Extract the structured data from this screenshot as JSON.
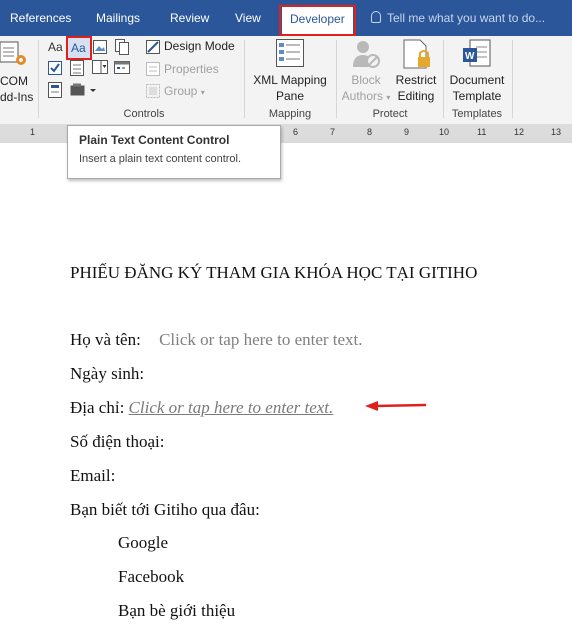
{
  "ribbon_tabs": {
    "references": "References",
    "mailings": "Mailings",
    "review": "Review",
    "view": "View",
    "developer": "Developer"
  },
  "tell_me": {
    "placeholder": "Tell me what you want to do..."
  },
  "ribbon": {
    "addins": {
      "com_addins_line1": "COM",
      "com_addins_line2": "dd-Ins"
    },
    "controls": {
      "design_mode": "Design Mode",
      "properties": "Properties",
      "group": "Group",
      "label": "Controls"
    },
    "mapping": {
      "xml_line1": "XML Mapping",
      "xml_line2": "Pane",
      "label": "Mapping"
    },
    "protect": {
      "block_line1": "Block",
      "block_line2": "Authors",
      "restrict_line1": "Restrict",
      "restrict_line2": "Editing",
      "label": "Protect"
    },
    "templates": {
      "doc_line1": "Document",
      "doc_line2": "Template",
      "label": "Templates"
    }
  },
  "ruler": {
    "ticks": [
      "1",
      "6",
      "7",
      "8",
      "9",
      "10",
      "11",
      "12",
      "13"
    ]
  },
  "tooltip": {
    "title": "Plain Text Content Control",
    "description": "Insert a plain text content control."
  },
  "document": {
    "title": "PHIẾU ĐĂNG KÝ THAM GIA KHÓA HỌC TẠI GITIHO",
    "fields": {
      "name_label": "Họ và tên:",
      "name_placeholder": "Click or tap here to enter text.",
      "dob_label": "Ngày sinh:",
      "address_label": "Địa chỉ:",
      "address_placeholder": "Click or tap here to enter text.",
      "phone_label": "Số điện thoại:",
      "email_label": "Email:",
      "source_label": "Bạn biết tới Gitiho qua đâu:"
    },
    "options": [
      "Google",
      "Facebook",
      "Bạn bè giới thiệu"
    ]
  },
  "colors": {
    "accent": "#2b579a",
    "highlight": "#e0201b",
    "placeholder": "#808080"
  }
}
